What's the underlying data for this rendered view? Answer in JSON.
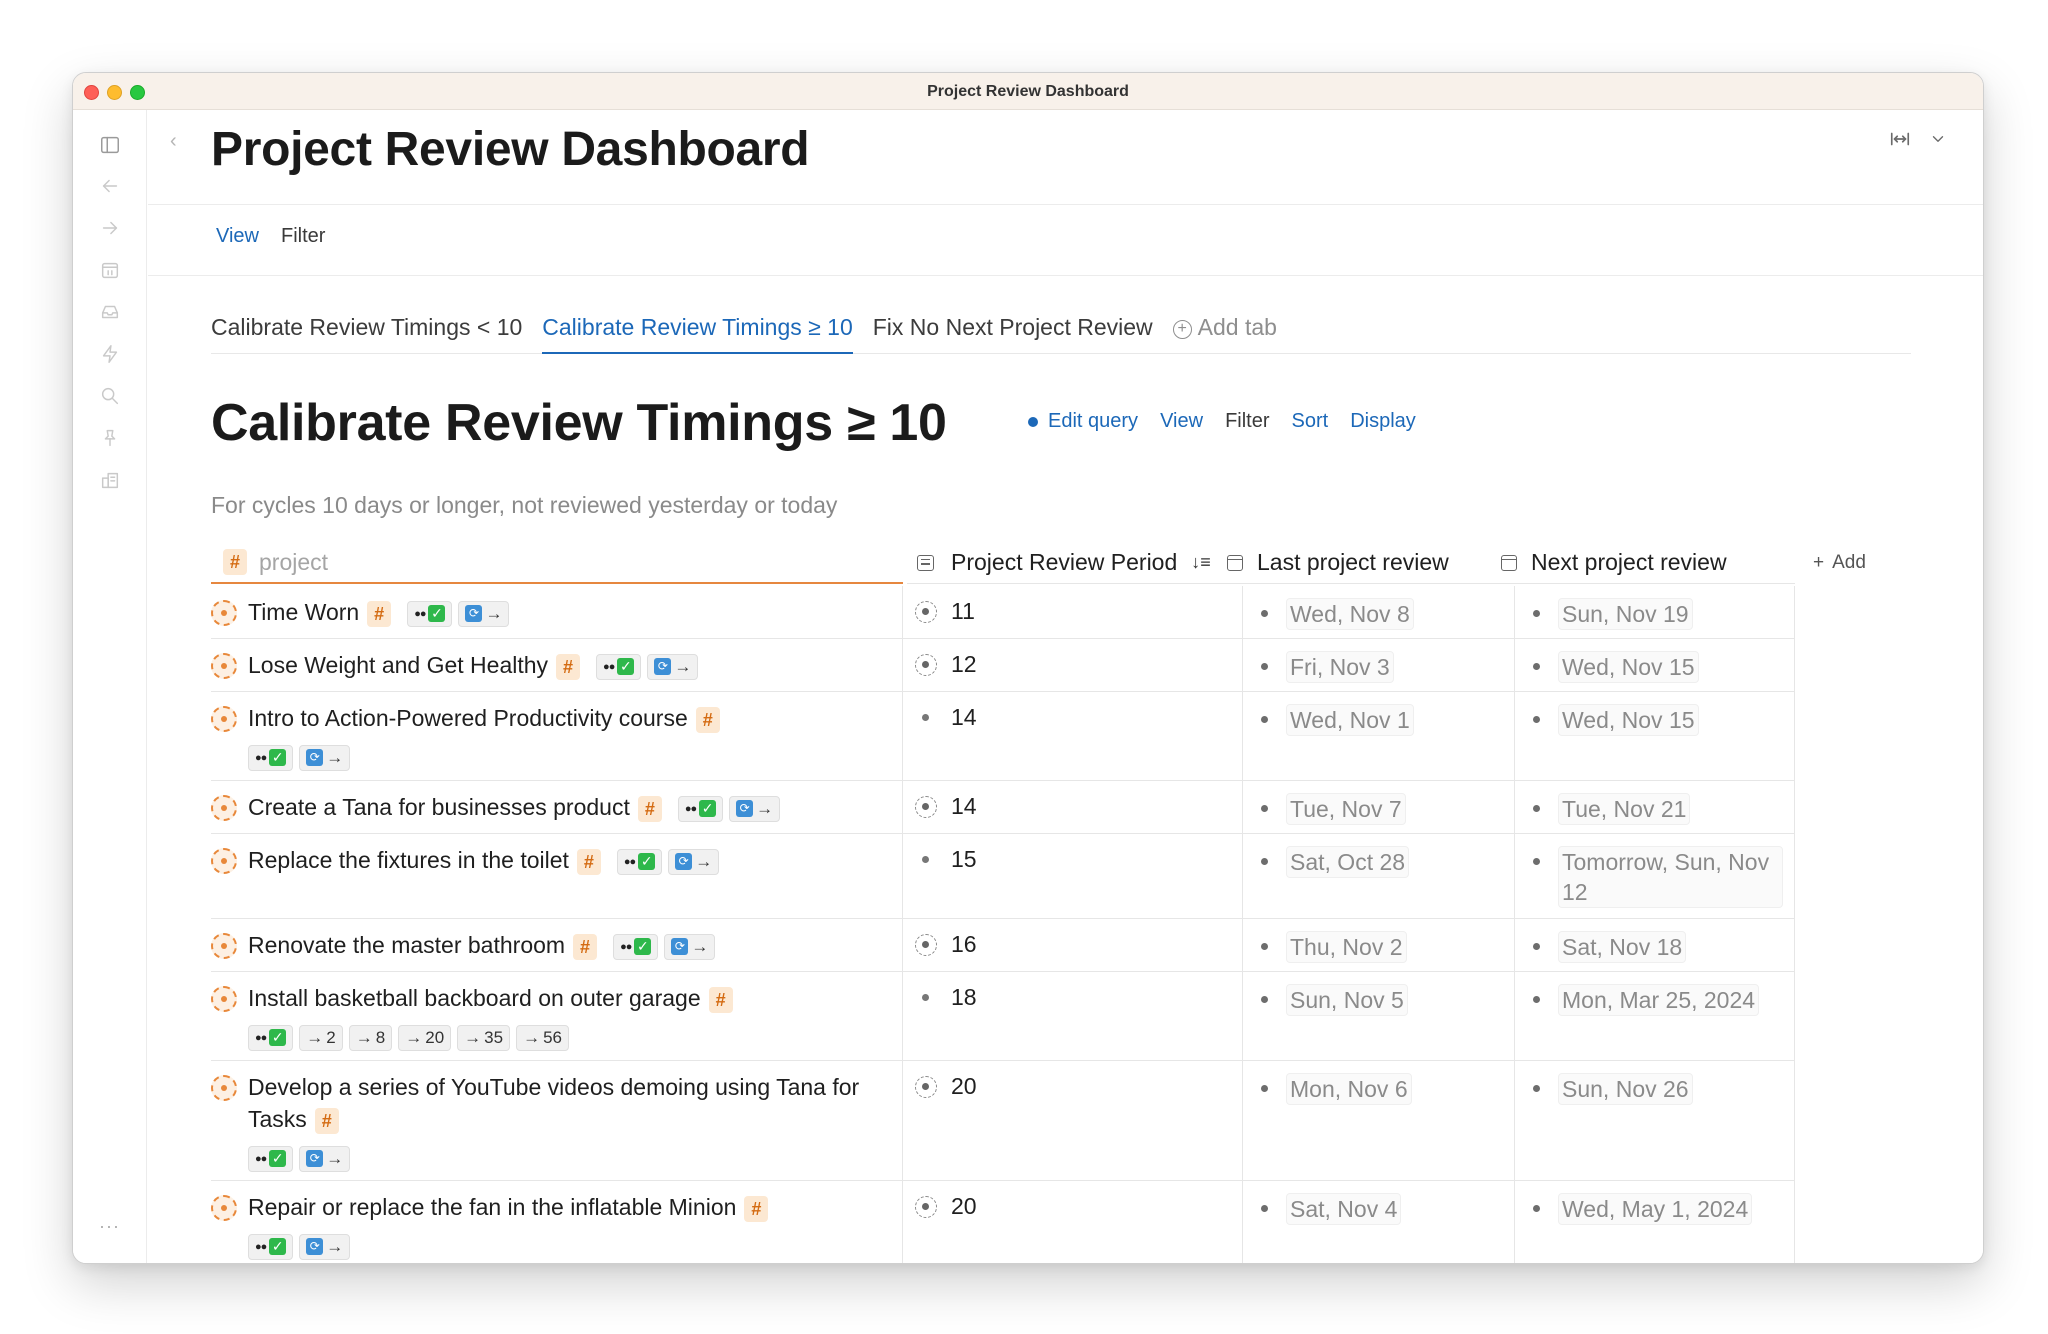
{
  "window": {
    "title": "Project Review Dashboard"
  },
  "page": {
    "title": "Project Review Dashboard"
  },
  "viewbar": {
    "view": "View",
    "filter": "Filter"
  },
  "tabs": [
    {
      "label": "Calibrate Review Timings < 10"
    },
    {
      "label": "Calibrate Review Timings ≥ 10"
    },
    {
      "label": "Fix No Next Project Review"
    },
    {
      "label": "Add tab"
    }
  ],
  "section": {
    "title": "Calibrate Review Timings ≥ 10",
    "edit_query": "Edit query",
    "view": "View",
    "filter": "Filter",
    "sort": "Sort",
    "display": "Display",
    "subtitle": "For cycles 10 days or longer, not reviewed yesterday or today"
  },
  "columns": {
    "project": "project",
    "period": "Project Review Period",
    "last": "Last project review",
    "next": "Next project review",
    "add": "Add"
  },
  "rows": [
    {
      "name": "Time Worn",
      "period": "11",
      "last": "Wed, Nov 8",
      "next": "Sun, Nov 19"
    },
    {
      "name": "Lose Weight and Get Healthy",
      "period": "12",
      "last": "Fri, Nov 3",
      "next": "Wed, Nov 15"
    },
    {
      "name": "Intro to Action-Powered Productivity course",
      "period": "14",
      "last": "Wed, Nov 1",
      "next": "Wed, Nov 15"
    },
    {
      "name": "Create a Tana for businesses product",
      "period": "14",
      "last": "Tue, Nov 7",
      "next": "Tue, Nov 21"
    },
    {
      "name": "Replace the fixtures in the toilet",
      "period": "15",
      "last": "Sat, Oct 28",
      "next": "Tomorrow, Sun, Nov 12"
    },
    {
      "name": "Renovate the master bathroom",
      "period": "16",
      "last": "Thu, Nov 2",
      "next": "Sat, Nov 18"
    },
    {
      "name": "Install basketball backboard on outer garage",
      "period": "18",
      "last": "Sun, Nov 5",
      "next": "Mon, Mar 25, 2024",
      "chips": [
        "2",
        "8",
        "20",
        "35",
        "56"
      ]
    },
    {
      "name": "Develop a series of YouTube videos demoing using Tana for Tasks",
      "period": "20",
      "last": "Mon, Nov 6",
      "next": "Sun, Nov 26"
    },
    {
      "name": "Repair or replace the fan in the inflatable Minion",
      "period": "20",
      "last": "Sat, Nov 4",
      "next": "Wed, May 1, 2024"
    }
  ],
  "colors": {
    "accent": "#1c68b8",
    "tag": "#e8883a",
    "done": "#2eb84b"
  }
}
